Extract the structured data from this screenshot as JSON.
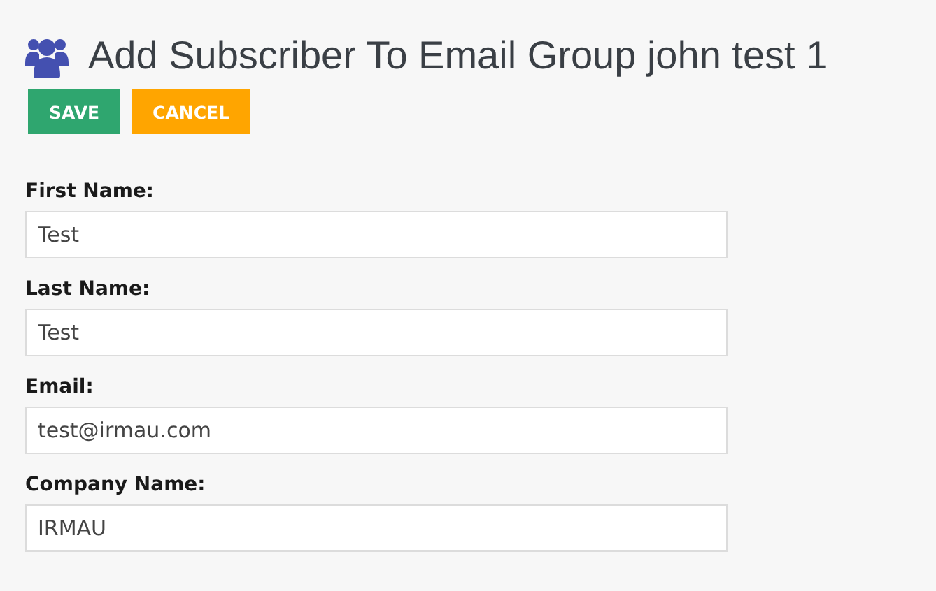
{
  "title": "Add Subscriber To Email Group john test 1",
  "buttons": [
    {
      "label": "SAVE",
      "kind": "primary"
    },
    {
      "label": "CANCEL",
      "kind": "warning"
    }
  ],
  "fields": [
    {
      "label": "First Name:",
      "value": "Test"
    },
    {
      "label": "Last Name:",
      "value": "Test"
    },
    {
      "label": "Email:",
      "value": "test@irmau.com"
    },
    {
      "label": "Company Name:",
      "value": "IRMAU"
    }
  ]
}
